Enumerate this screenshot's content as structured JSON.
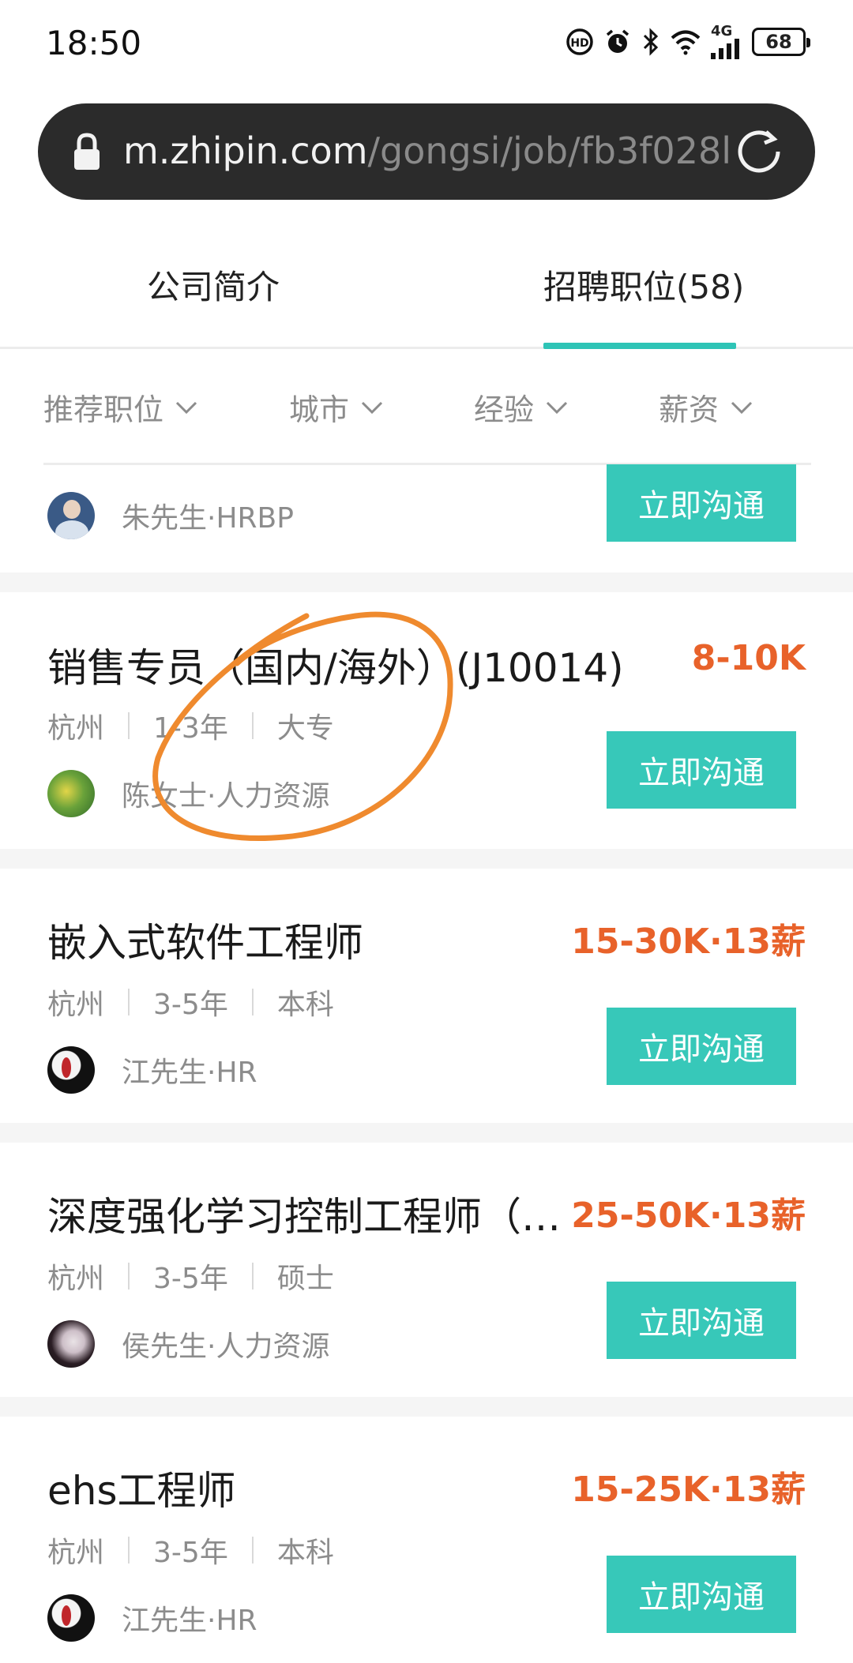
{
  "status_bar": {
    "time": "18:50",
    "network": "4G",
    "battery": "68",
    "icons": [
      "hd-icon",
      "alarm-icon",
      "bluetooth-icon",
      "wifi-icon",
      "signal-icon",
      "battery-icon"
    ]
  },
  "url_bar": {
    "host": "m.zhipin.com",
    "path": "/gongsi/job/fb3f028l"
  },
  "tabs": [
    {
      "label": "公司简介",
      "active": false
    },
    {
      "label": "招聘职位(58)",
      "active": true
    }
  ],
  "filters": [
    {
      "label": "推荐职位"
    },
    {
      "label": "城市"
    },
    {
      "label": "经验"
    },
    {
      "label": "薪资"
    }
  ],
  "partial_card": {
    "recruiter": "朱先生·HRBP",
    "button": "立即沟通"
  },
  "jobs": [
    {
      "title": "销售专员（国内/海外）(J10014)",
      "salary": "8-10K",
      "city": "杭州",
      "experience": "1-3年",
      "education": "大专",
      "recruiter": "陈女士·人力资源",
      "button": "立即沟通"
    },
    {
      "title": "嵌入式软件工程师",
      "salary": "15-30K·13薪",
      "city": "杭州",
      "experience": "3-5年",
      "education": "本科",
      "recruiter": "江先生·HR",
      "button": "立即沟通"
    },
    {
      "title": "深度强化学习控制工程师（…",
      "salary": "25-50K·13薪",
      "city": "杭州",
      "experience": "3-5年",
      "education": "硕士",
      "recruiter": "侯先生·人力资源",
      "button": "立即沟通"
    },
    {
      "title": "ehs工程师",
      "salary": "15-25K·13薪",
      "city": "杭州",
      "experience": "3-5年",
      "education": "本科",
      "recruiter": "江先生·HR",
      "button": "立即沟通"
    }
  ],
  "colors": {
    "accent": "#37c8b9",
    "salary": "#e8622a",
    "annotation": "#ef8a2e"
  }
}
